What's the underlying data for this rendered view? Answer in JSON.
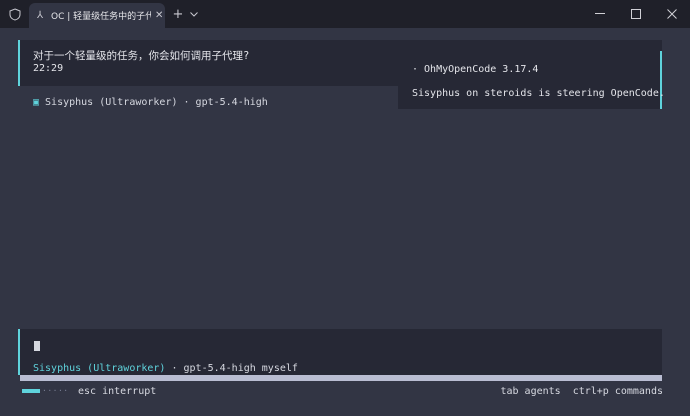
{
  "window": {
    "tab_title": "OC | 轻量级任务中的子代理调",
    "tab_icon": "terminal-icon",
    "new_tab": "+",
    "tab_menu": "⌄",
    "controls": {
      "minimize": "—",
      "maximize": "☐",
      "close": "✕"
    }
  },
  "message": {
    "text": "对于一个轻量级的任务，你会如何调用子代理?",
    "time": "22:29"
  },
  "session": {
    "agent_line": "Sisyphus (Ultraworker) · gpt-5.4-high"
  },
  "toast": {
    "title": "· OhMyOpenCode 3.17.4",
    "body": "Sisyphus on steroids is steering OpenCode."
  },
  "input": {
    "agent": "Sisyphus (Ultraworker)",
    "model": " · gpt-5.4-high myself"
  },
  "footer": {
    "interrupt": "esc interrupt",
    "tab_agents": "tab agents",
    "commands": "ctrl+p commands",
    "progress_dots": "·····"
  },
  "colors": {
    "accent": "#5fd3dc",
    "background": "#323544",
    "panel": "#262835",
    "titlebar": "#1f2029"
  }
}
